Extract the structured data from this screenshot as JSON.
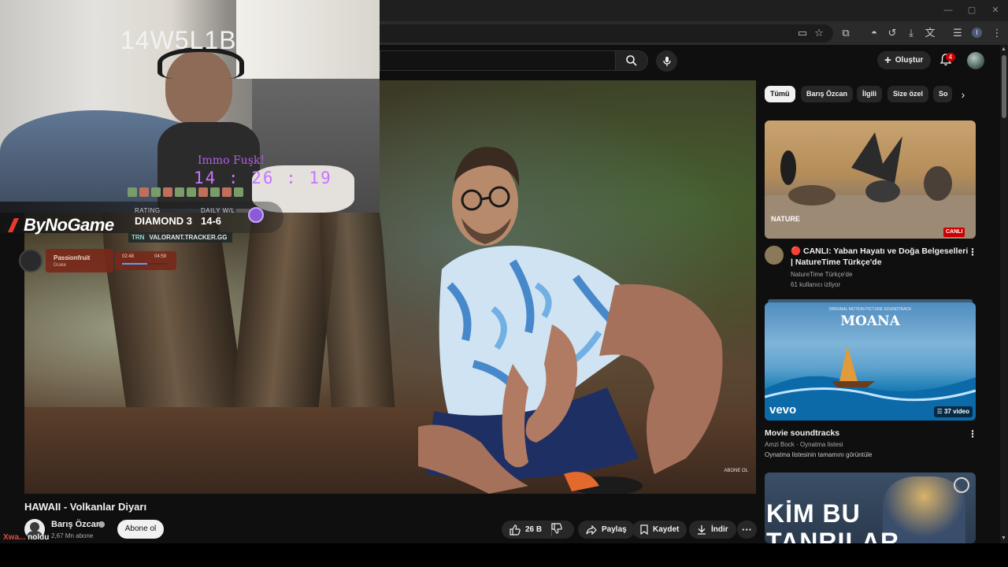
{
  "browser": {
    "window_controls": [
      "—",
      "▢",
      "✕"
    ],
    "profile_initial": "I"
  },
  "header": {
    "create_label": "Oluştur",
    "notif_count": "4"
  },
  "video": {
    "title": "HAWAII - Volkanlar Diyarı",
    "watermark": "ABONE OL",
    "channel": "Barış Özcan",
    "subscribers": "2,67 Mn abone",
    "subscribe_label": "Abone ol",
    "likes": "26 B",
    "share_label": "Paylaş",
    "save_label": "Kaydet",
    "download_label": "İndir"
  },
  "overlay": {
    "cam_handle": "14W5L1B",
    "immo_label": "Immo Fuşk!",
    "timer": "14 : 26 : 19",
    "brand": "ByNoGame",
    "rating_label": "RATING",
    "rating_value": "DIAMOND 3",
    "daily_label": "DAILY W/L",
    "daily_value": "14-6",
    "tracker": "VALORANT.TRACKER.GG",
    "tracker_prefix": "TRN",
    "song": "Passionfruit",
    "artist": "Drake",
    "time_current": "02:48",
    "time_total": "04:59",
    "music_progress": 0.56,
    "chat_user": "Xwa...",
    "chat_msg": "noldu"
  },
  "chips": [
    "Tümü",
    "Barış Özcan",
    "İlgili",
    "Size özel",
    "So"
  ],
  "recommendations": [
    {
      "title_line1": "🔴 CANLI: Yaban Hayatı ve Doğa Belgeselleri",
      "title_line2": "| NatureTime Türkçe'de",
      "channel": "NatureTime Türkçe'de",
      "meta": "61 kullanıcı izliyor",
      "badge": "CANLI",
      "thumb_text": "NATURE"
    },
    {
      "title_line1": "Movie soundtracks",
      "channel": "Amzi Bock · Oynatma listesi",
      "meta": "Oynatma listesinin tamamını görüntüle",
      "badge": "37 video",
      "thumb_text": "MOANA",
      "thumb_sub": "ORIGINAL MOTION PICTURE SOUNDTRACK",
      "thumb_brand": "vevo"
    },
    {
      "thumb_text": "KİM BU",
      "thumb_text2": "TANRILAR"
    }
  ]
}
